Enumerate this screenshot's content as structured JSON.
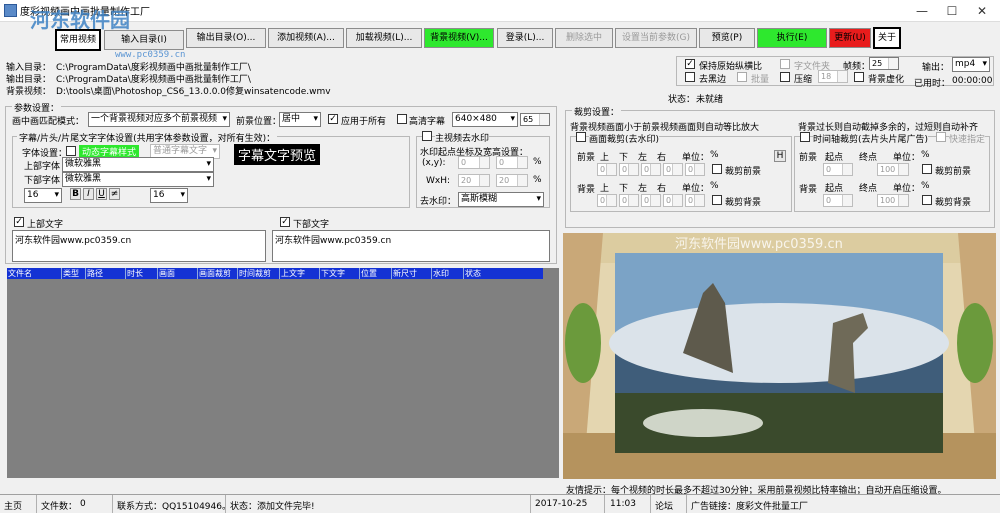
{
  "window": {
    "title": "度彩视频画中画批量制作工厂",
    "watermark": "河东软件园",
    "watermark_url": "www.pc0359.cn",
    "min": "—",
    "max": "☐",
    "close": "✕"
  },
  "toolbar": {
    "mode": "常用视频",
    "buttons": [
      "输入目录(I)",
      "输出目录(O)...",
      "添加视频(A)...",
      "加载视频(L)...",
      "背景视频(V)...",
      "登录(L)...",
      "删除选中",
      "设置当前参数(G)",
      "预览(P)",
      "执行(E)",
      "更新(U)",
      "关于"
    ]
  },
  "paths": {
    "input_label": "输入目录：",
    "input_value": "C:\\ProgramData\\度彩视频画中画批量制作工厂\\",
    "output_label": "输出目录：",
    "output_value": "C:\\ProgramData\\度彩视频画中画批量制作工厂\\",
    "bg_label": "背景视频：",
    "bg_value": "D:\\tools\\桌面\\Photoshop_CS6_13.0.0.0修复winsatencode.wmv"
  },
  "options": {
    "keep_aspect": "保持原始纵横比",
    "subtitle": "字文件夹",
    "frame_rate_label": "帧频：",
    "frame_rate": "25",
    "output_label": "输出：",
    "output_format": "mp4",
    "remove_black": "去黑边",
    "batch": "批量",
    "compress": "压缩",
    "compress_val": "18",
    "bg_blur": "背景虚化",
    "elapsed_label": "已用时：",
    "elapsed": "00:00:00",
    "status_label": "状态：",
    "status_value": "未就绪"
  },
  "params": {
    "title": "参数设置：",
    "pip_mode_label": "画中画匹配模式：",
    "pip_mode": "一个背景视频对应多个前景视频",
    "fg_pos_label": "前景位置：",
    "fg_pos": "居中",
    "apply_all": "应用于所有",
    "hd_sub": "高清字幕",
    "resolution": "640×480",
    "res_num": "65",
    "font_group": "字幕/片头/片尾文字字体设置(共用字体参数设置，对所有生效)：",
    "font_label": "字体设置：",
    "font_mode1": "动态字幕样式",
    "font_mode2": "普通字幕文字",
    "preview_text": "字幕文字预览",
    "upper_font_label": "上部字体",
    "upper_font": "微软雅黑",
    "lower_font_label": "下部字体",
    "lower_font": "微软雅黑",
    "size1": "16",
    "size2": "16",
    "b": "B",
    "i": "I",
    "u": "U",
    "s": "≠",
    "wm_group": "主视频去水印",
    "wm_pos_label": "水印起点坐标及宽高设置：",
    "xy": "(x,y):",
    "wh": "WxH:",
    "x": "0",
    "y": "0",
    "w": "20",
    "h": "20",
    "pct": "%",
    "remove_wm_label": "去水印：",
    "remove_wm": "高斯模糊",
    "upper_text_label": "上部文字",
    "upper_text": "河东软件园www.pc0359.cn",
    "lower_text_label": "下部文字",
    "lower_text": "河东软件园www.pc0359.cn"
  },
  "crop": {
    "title": "裁剪设置：",
    "desc1": "背景视频画面小于前景视频画面则自动等比放大",
    "desc2": "背景过长则自动截掉多余的，过短则自动补齐",
    "frame_crop": "画面裁剪(去水印)",
    "time_crop": "时间轴裁剪(去片头片尾广告)",
    "quick": "快速指定",
    "fg": "前景",
    "bg": "背景",
    "up": "上",
    "down": "下",
    "left": "左",
    "right": "右",
    "unit": "单位：",
    "pct": "%",
    "h": "H",
    "crop_fg": "裁剪前景",
    "crop_bg": "裁剪背景",
    "start": "起点",
    "end": "终点",
    "zero": "0",
    "hundred": "100"
  },
  "table": {
    "headers": [
      "文件名",
      "类型",
      "路径",
      "时长",
      "画面",
      "画面裁剪",
      "时间裁剪",
      "上文字",
      "下文字",
      "位置",
      "新尺寸",
      "水印",
      "状态"
    ]
  },
  "preview": {
    "watermark": "河东软件园www.pc0359.cn"
  },
  "tip": "友情提示：每个视频的时长最多不超过30分钟；采用前景视频比特率输出；自动开启压缩设置。",
  "statusbar": {
    "home": "主页",
    "files_label": "文件数：",
    "files": "0",
    "contact": "联系方式：QQ15104946。",
    "state": "状态：添加文件完毕!",
    "date": "2017-10-25",
    "time": "11:03",
    "forum": "论坛",
    "ad": "广告链接：度彩文件批量工厂"
  }
}
